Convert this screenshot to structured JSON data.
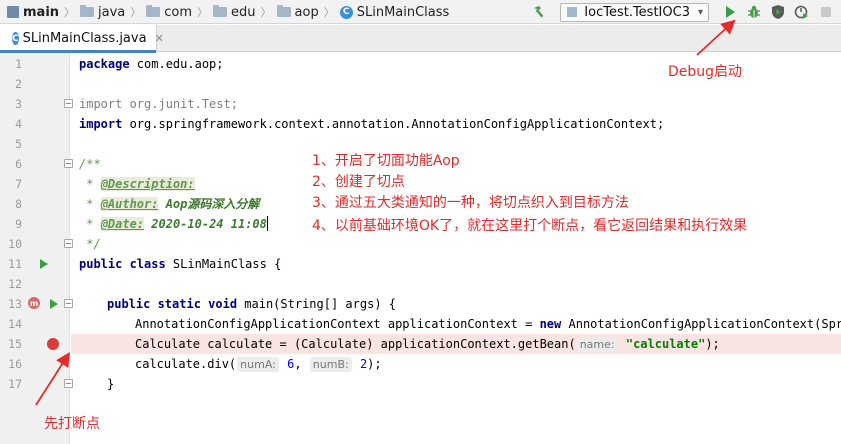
{
  "breadcrumbs": {
    "module": "main",
    "items": [
      "java",
      "com",
      "edu",
      "aop"
    ],
    "file_class": "SLinMainClass"
  },
  "toolbar": {
    "run_config": "IocTest.TestIOC3"
  },
  "tab": {
    "label": "SLinMainClass.java"
  },
  "editor": {
    "line_numbers": [
      "1",
      "2",
      "3",
      "4",
      "5",
      "6",
      "7",
      "8",
      "9",
      "10",
      "11",
      "12",
      "13",
      "14",
      "15",
      "16",
      "17"
    ],
    "code": {
      "l1_kw": "package",
      "l1_rest": " com.edu.aop;",
      "l3_kw": "import",
      "l3_rest": " org.junit.Test;",
      "l4_kw": "import",
      "l4_rest": " org.springframework.context.annotation.AnnotationConfigApplicationContext;",
      "l6": "/**",
      "l7_pre": " * ",
      "l7_tag": "@Description:",
      "l8_pre": " * ",
      "l8_tag": "@Author:",
      "l8_val": " Aop源码深入分解",
      "l9_pre": " * ",
      "l9_tag": "@Date:",
      "l9_val": " 2020-10-24 11:08",
      "l10": " */",
      "l11_kw": "public class",
      "l11_rest": " SLinMainClass {",
      "l13_kw": "public static void",
      "l13_rest": " main(String[] args) {",
      "l14_a": "AnnotationConfigApplicationContext applicationContext = ",
      "l14_kw": "new",
      "l14_b": " AnnotationConfigApplicationContext(Spring",
      "l15_a": "Calculate calculate = (Calculate) applicationContext.getBean(",
      "l15_hint": "name:",
      "l15_str": "\"calculate\"",
      "l15_b": ");",
      "l16_a": "calculate.div(",
      "l16_hint1": "numA:",
      "l16_n1": "6",
      "l16_sep": ", ",
      "l16_hint2": "numB:",
      "l16_n2": "2",
      "l16_b": ");",
      "l17": "}"
    }
  },
  "annotations": {
    "debug_start": "Debug启动",
    "notes": [
      "1、开启了切面功能Aop",
      "2、创建了切点",
      "3、通过五大类通知的一种，将切点织入到目标方法",
      "4、以前基础环境OK了，就在这里打个断点，看它返回结果和执行效果"
    ],
    "breakpoint_first": "先打断点"
  },
  "colors": {
    "annotation_red": "#e42a2a",
    "breakpoint_red": "#db3b3b",
    "run_green": "#389e3f",
    "keyword_navy": "#000080",
    "doc_green": "#629755"
  }
}
